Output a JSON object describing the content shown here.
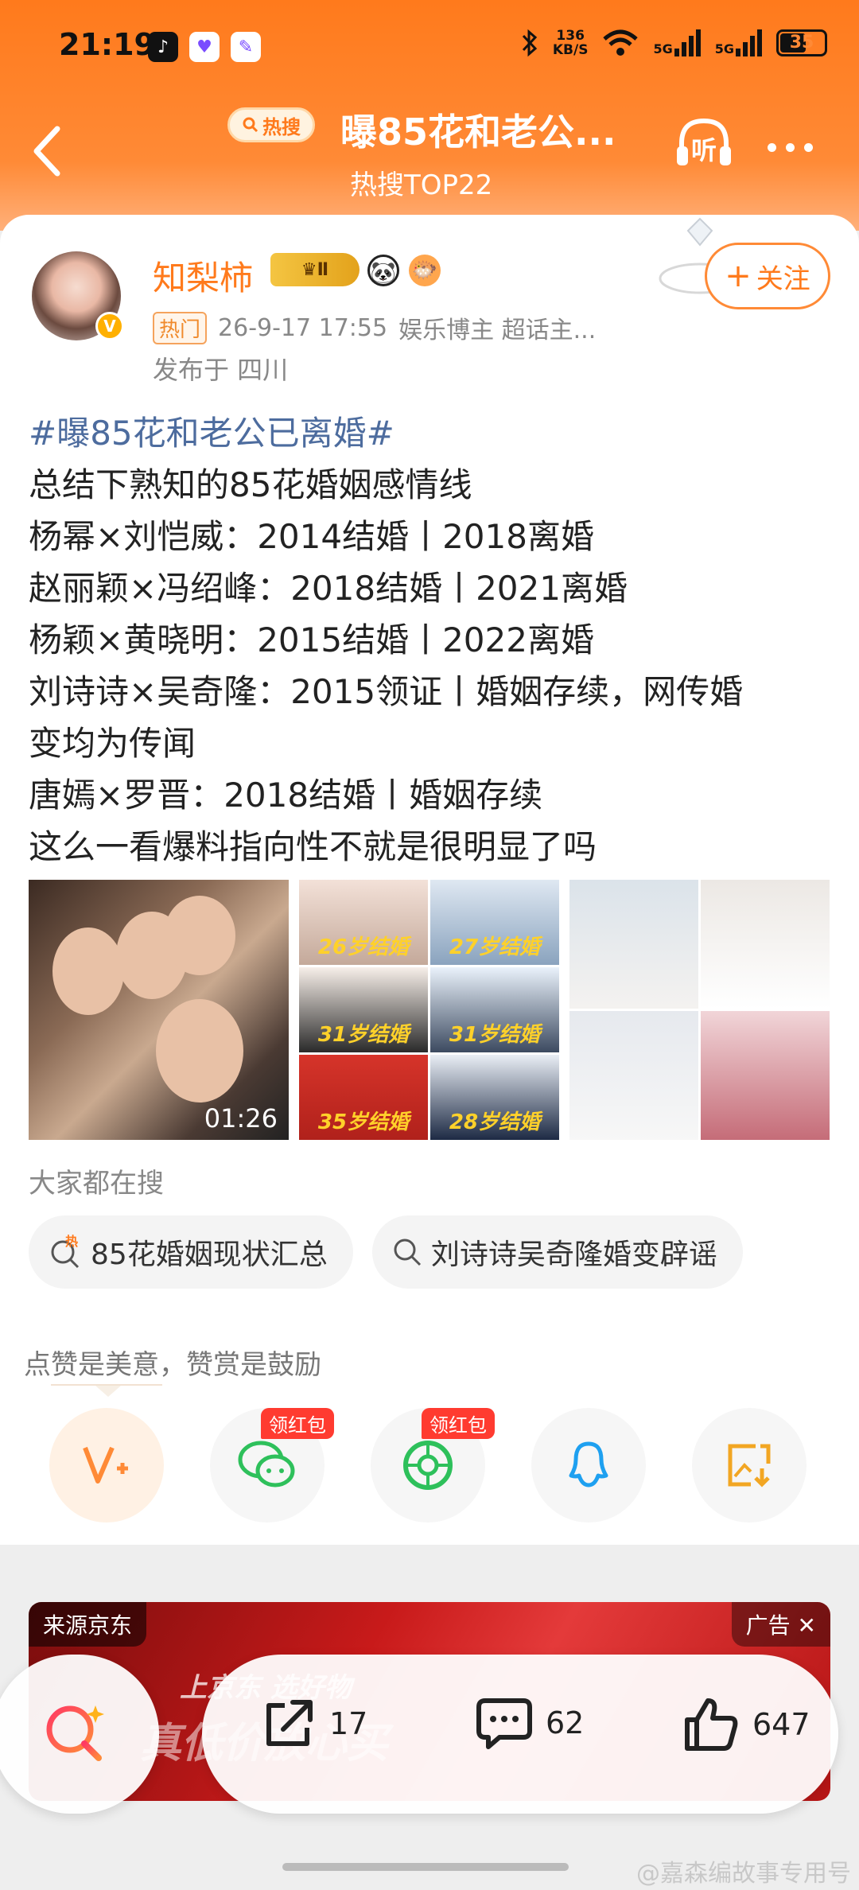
{
  "status_bar": {
    "time": "21:19",
    "net_speed_value": "136",
    "net_speed_unit": "KB/S",
    "battery": "35",
    "sim1": "5G",
    "sim2": "5G"
  },
  "header": {
    "hot_badge": "热搜",
    "title": "曝85花和老公...",
    "subtitle": "热搜TOP22",
    "listen_label": "听"
  },
  "post": {
    "username": "知梨柿",
    "vip_level": "Ⅱ",
    "tag": "热门",
    "date": "26-9-17 17:55",
    "identity": "娱乐博主 超话主...",
    "location": "发布于 四川",
    "follow_label": "关注",
    "content": {
      "hashtag": "#曝85花和老公已离婚#",
      "lines": [
        "总结下熟知的85花婚姻感情线",
        "杨幂×刘恺威：2014结婚丨2018离婚",
        "赵丽颖×冯绍峰：2018结婚丨2021离婚",
        "杨颖×黄晓明：2015结婚丨2022离婚",
        "刘诗诗×吴奇隆：2015领证丨婚姻存续，网传婚",
        "变均为传闻",
        "唐嫣×罗晋：2018结婚丨婚姻存续",
        "这么一看爆料指向性不就是很明显了吗"
      ]
    },
    "video_duration": "01:26",
    "collage_labels": [
      "26岁结婚",
      "27岁结婚",
      "31岁结婚",
      "31岁结婚",
      "35岁结婚",
      "28岁结婚"
    ]
  },
  "search": {
    "title": "大家都在搜",
    "suggestions": [
      "85花婚姻现状汇总",
      "刘诗诗吴奇隆婚变辟谣"
    ],
    "hot_mark": "热"
  },
  "reward": {
    "text": "点赞是美意，赞赏是鼓励",
    "red_packet_label": "领红包"
  },
  "ad": {
    "source": "来源京东",
    "label": "广告",
    "slogan_small": "上京东 选好物",
    "slogan_big": "真低价放心买"
  },
  "actions": {
    "repost": "17",
    "comment": "62",
    "like": "647"
  },
  "watermark": "@嘉森编故事专用号",
  "colors": {
    "accent": "#ff7a1c",
    "hashtag": "#4d6c9e",
    "wechat": "#2ec05b",
    "qq": "#1ea0f0",
    "red_tag": "#ff3b30"
  }
}
